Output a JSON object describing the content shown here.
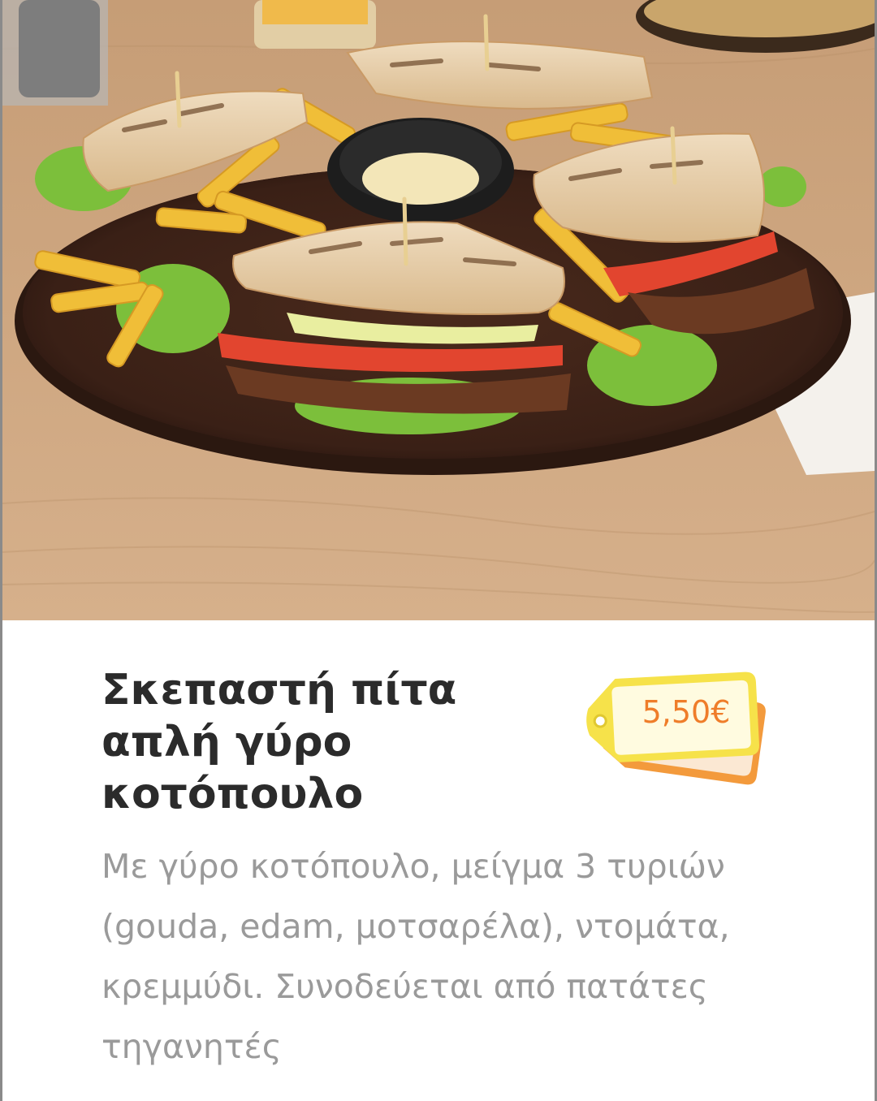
{
  "item": {
    "image_alt": "Σκεπαστή πίτα απλή γύρο κοτόπουλο",
    "title": "Σκεπαστή πίτα απλή γύρο κοτόπουλο",
    "price": "5,50€",
    "description": "Με γύρο κοτόπουλο, μείγμα 3 τυριών (gouda, edam, μοτσαρέλα), ντομάτα, κρεμμύδι. Συνοδεύεται από πατάτες τηγανητές"
  },
  "colors": {
    "title": "#2b2b2b",
    "description": "#9a9a9a",
    "price_text": "#ef7d2a",
    "tag_front": "#f6e24a",
    "tag_back": "#f39a3c",
    "card_border": "#8a8a8a"
  },
  "icons": {
    "price_tag": "price-tag-icon"
  }
}
